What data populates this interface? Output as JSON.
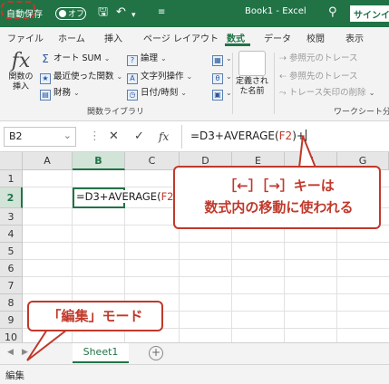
{
  "titlebar": {
    "autosave_label": "自動保存",
    "autosave_state": "オフ",
    "save_icon": "save-icon",
    "undo_icon": "undo-icon",
    "more_icon": "customize-icon",
    "title": "Book1 - Excel",
    "search_icon": "search-icon",
    "signin_label": "サインイ"
  },
  "tabs": [
    "ファイル",
    "ホーム",
    "挿入",
    "ページ レイアウト",
    "数式",
    "データ",
    "校閲",
    "表示"
  ],
  "active_tab": "数式",
  "ribbon": {
    "insert_function": {
      "icon": "fx",
      "line1": "関数の",
      "line2": "挿入"
    },
    "autosum": "オート SUM",
    "recent": "最近使った関数",
    "financial": "財務",
    "logical": "論理",
    "text": "文字列操作",
    "datetime": "日付/時刻",
    "group_library": "関数ライブラリ",
    "defined_names": {
      "line1": "定義され",
      "line2": "た名前"
    },
    "trace_precedents": "参照元のトレース",
    "trace_dependents": "参照先のトレース",
    "remove_arrows": "トレース矢印の削除",
    "group_audit": "ワークシート分"
  },
  "formula_bar": {
    "name_box": "B2",
    "cancel": "✕",
    "enter": "✓",
    "fx": "fx",
    "formula_prefix": "=D3+AVERAGE(",
    "formula_ref": "F2",
    "formula_suffix": ")+"
  },
  "grid": {
    "columns": [
      "A",
      "B",
      "C",
      "D",
      "E",
      "F",
      "G"
    ],
    "rows": [
      "1",
      "2",
      "3",
      "4",
      "5",
      "6",
      "7",
      "8",
      "9",
      "10"
    ],
    "active_cell": "B2",
    "cell_prefix": "=D3+AVERAGE(",
    "cell_ref": "F2"
  },
  "sheets": {
    "tab": "Sheet1",
    "add": "+"
  },
  "status": {
    "mode": "編集"
  },
  "callouts": {
    "keys_line1": "［←］［→］キーは",
    "keys_line2": "数式内の移動に使われる",
    "mode": "「編集」モード"
  },
  "colors": {
    "accent": "#217346",
    "callout": "#c0392b",
    "formula_ref": "#c0392b"
  }
}
